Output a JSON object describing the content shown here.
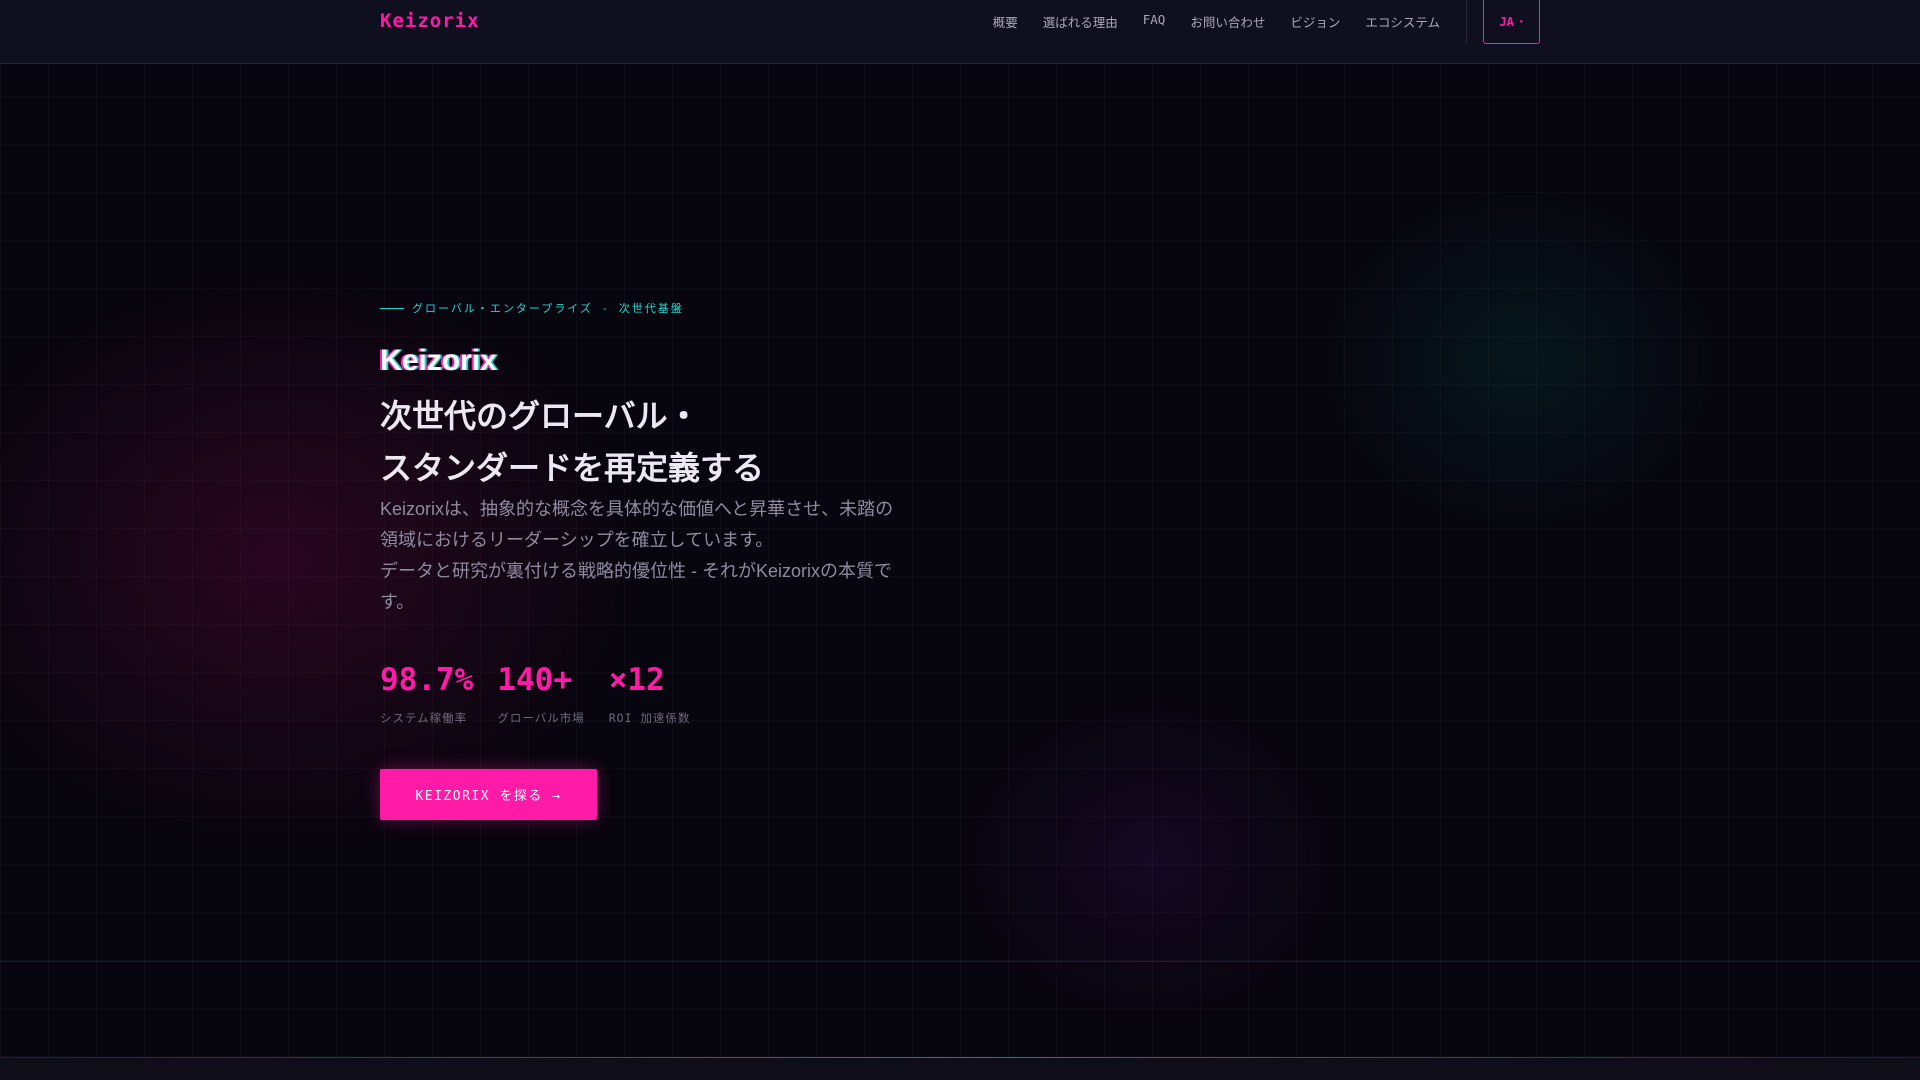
{
  "header": {
    "logo": "Keizorix",
    "nav": [
      "概要",
      "選ばれる理由",
      "FAQ",
      "お問い合わせ",
      "ビジョン",
      "エコシステム"
    ],
    "lang_label": "JA",
    "lang_caret": "▾"
  },
  "hero": {
    "eyebrow": "グローバル・エンタープライズ - 次世代基盤",
    "brand": "Keizorix",
    "headline_line1": "次世代のグローバル・",
    "headline_line2": "スタンダードを再定義する",
    "description_line1": "Keizorixは、抽象的な概念を具体的な価値へと昇華させ、未踏の領域におけるリーダーシップを確立しています。",
    "description_line2": "データと研究が裏付ける戦略的優位性 - それがKeizorixの本質です。",
    "stats": [
      {
        "value": "98.7%",
        "label": "システム稼働率"
      },
      {
        "value": "140+",
        "label": "グローバル市場"
      },
      {
        "value": "×12",
        "label": "ROI 加速係数"
      }
    ],
    "cta_label": "KEIZORIX を探る →"
  },
  "colors": {
    "accent": "#ff1aa8",
    "secondary": "#21d6d0",
    "background": "#07050d",
    "header_bg": "#100f1f"
  }
}
